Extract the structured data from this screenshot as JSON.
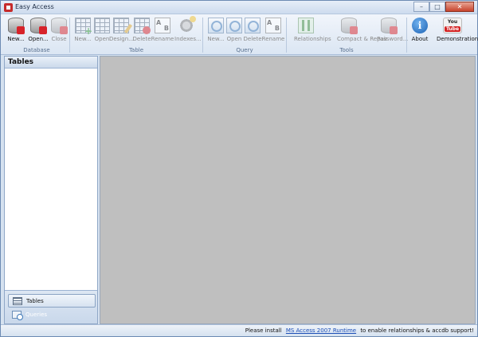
{
  "window": {
    "title": "Easy Access",
    "controls": {
      "minimize": "–",
      "maximize": "□",
      "close": "✕"
    }
  },
  "ribbon": {
    "groups": [
      {
        "label": "Database",
        "buttons": [
          {
            "label": "New...",
            "icon": "new-database-icon",
            "enabled": true
          },
          {
            "label": "Open...",
            "icon": "open-database-icon",
            "enabled": true
          },
          {
            "label": "Close",
            "icon": "close-database-icon",
            "enabled": false
          }
        ]
      },
      {
        "label": "Table",
        "buttons": [
          {
            "label": "New...",
            "icon": "new-table-icon",
            "enabled": false
          },
          {
            "label": "Open",
            "icon": "open-table-icon",
            "enabled": false
          },
          {
            "label": "Design...",
            "icon": "design-table-icon",
            "enabled": false
          },
          {
            "label": "Delete",
            "icon": "delete-table-icon",
            "enabled": false
          },
          {
            "label": "Rename",
            "icon": "rename-table-icon",
            "enabled": false
          },
          {
            "label": "Indexes...",
            "icon": "indexes-icon",
            "enabled": false
          }
        ]
      },
      {
        "label": "Query",
        "buttons": [
          {
            "label": "New...",
            "icon": "new-query-icon",
            "enabled": false
          },
          {
            "label": "Open",
            "icon": "open-query-icon",
            "enabled": false
          },
          {
            "label": "Delete",
            "icon": "delete-query-icon",
            "enabled": false
          },
          {
            "label": "Rename",
            "icon": "rename-query-icon",
            "enabled": false
          }
        ]
      },
      {
        "label": "Tools",
        "buttons": [
          {
            "label": "Relationships",
            "icon": "relationships-icon",
            "enabled": false
          },
          {
            "label": "Compact & Repair",
            "icon": "compact-repair-icon",
            "enabled": false
          },
          {
            "label": "Password...",
            "icon": "password-icon",
            "enabled": false
          }
        ]
      },
      {
        "label": "",
        "buttons": [
          {
            "label": "About",
            "icon": "info-icon",
            "enabled": true
          },
          {
            "label": "Demonstration",
            "icon": "youtube-icon",
            "enabled": true
          }
        ]
      }
    ]
  },
  "sidebar": {
    "header": "Tables",
    "nav": [
      {
        "label": "Tables",
        "active": true
      },
      {
        "label": "Queries",
        "active": false
      }
    ]
  },
  "youtube_logo": {
    "top": "You",
    "bottom": "Tube"
  },
  "status": {
    "prefix": "Please install",
    "link": "MS Access 2007 Runtime",
    "suffix": "to enable relationships & accdb support!"
  }
}
